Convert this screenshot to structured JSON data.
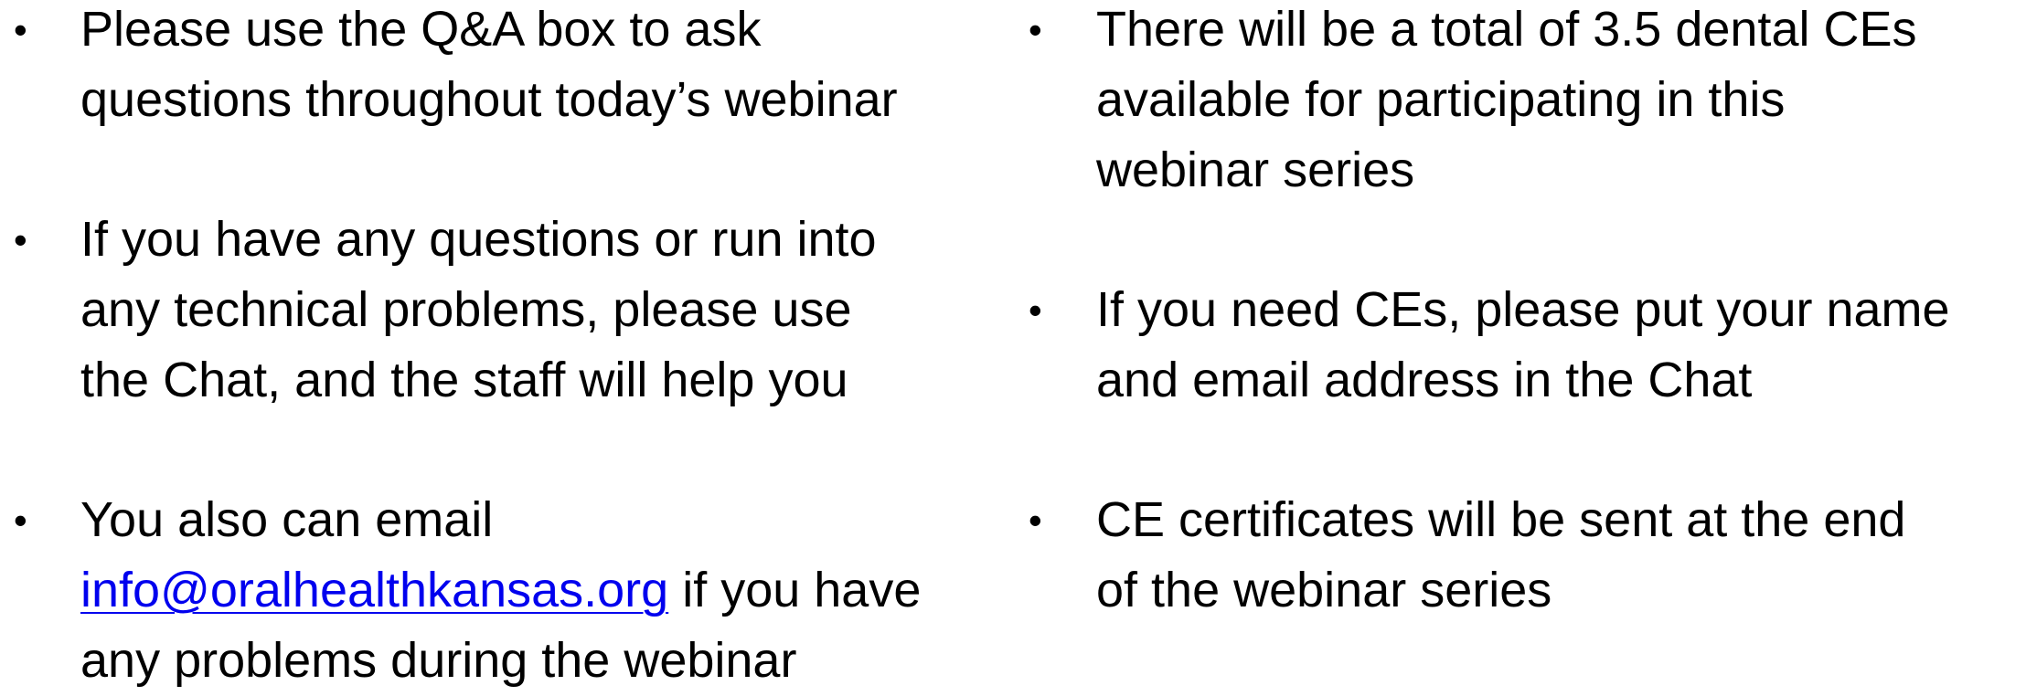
{
  "left_column": {
    "items": [
      {
        "lines": [
          "Please use the Q&A box to ask",
          "questions throughout today’s webinar"
        ]
      },
      {
        "lines": [
          "If you have any questions or run into",
          "any technical problems, please use",
          "the Chat, and the staff will help you"
        ]
      },
      {
        "line1": "You also can email",
        "link_text": "info@oralhealthkansas.org",
        "line2_after_link": " if you have",
        "line3": "any problems during the webinar"
      }
    ]
  },
  "right_column": {
    "items": [
      {
        "lines": [
          "There will be a total of 3.5 dental CEs",
          "available for participating in this",
          "webinar series"
        ]
      },
      {
        "lines": [
          "If you need CEs, please put your name",
          "and email address in the Chat"
        ]
      },
      {
        "lines": [
          "CE certificates will be sent at the end",
          "of the webinar series"
        ]
      }
    ]
  },
  "bullet_char": "•",
  "colors": {
    "text": "#000000",
    "link": "#0000ee",
    "background": "#ffffff"
  }
}
